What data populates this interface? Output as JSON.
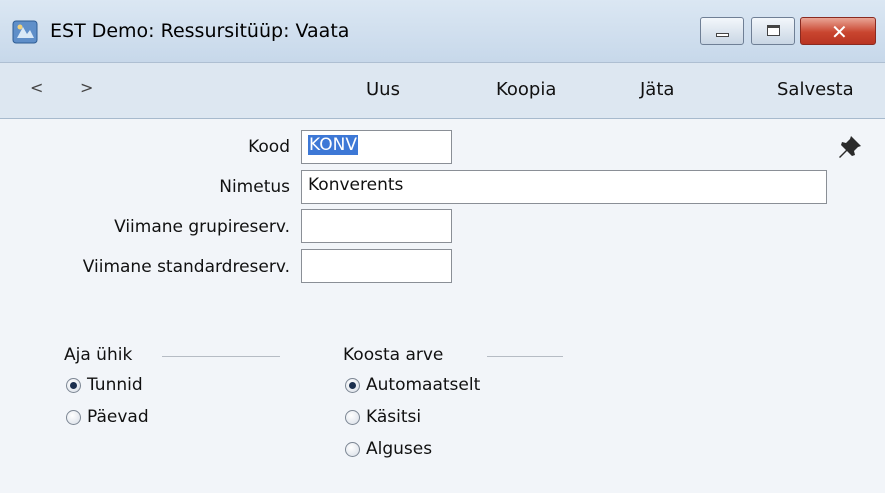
{
  "window": {
    "title": "EST Demo: Ressursitüüp: Vaata",
    "controls": {
      "minimize": "minimize",
      "maximize": "maximize",
      "close": "close"
    }
  },
  "toolbar": {
    "prev": "<",
    "next": ">",
    "new_label": "Uus",
    "copy_label": "Koopia",
    "skip_label": "Jäta",
    "save_label": "Salvesta"
  },
  "form": {
    "kood": {
      "label": "Kood",
      "value": "KONV"
    },
    "nimetus": {
      "label": "Nimetus",
      "value": "Konverents"
    },
    "grupireserv": {
      "label": "Viimane grupireserv.",
      "value": ""
    },
    "standardreserv": {
      "label": "Viimane standardreserv.",
      "value": ""
    }
  },
  "time_unit": {
    "title": "Aja ühik",
    "options": [
      {
        "label": "Tunnid",
        "checked": true
      },
      {
        "label": "Päevad",
        "checked": false
      }
    ]
  },
  "invoice": {
    "title": "Koosta arve",
    "options": [
      {
        "label": "Automaatselt",
        "checked": true
      },
      {
        "label": "Käsitsi",
        "checked": false
      },
      {
        "label": "Alguses",
        "checked": false
      }
    ]
  },
  "icons": {
    "app": "app-window-icon",
    "pin": "pin-icon"
  },
  "colors": {
    "selection": "#3d78d6",
    "close_button": "#c9452f",
    "form_background": "#f2f5f9"
  }
}
